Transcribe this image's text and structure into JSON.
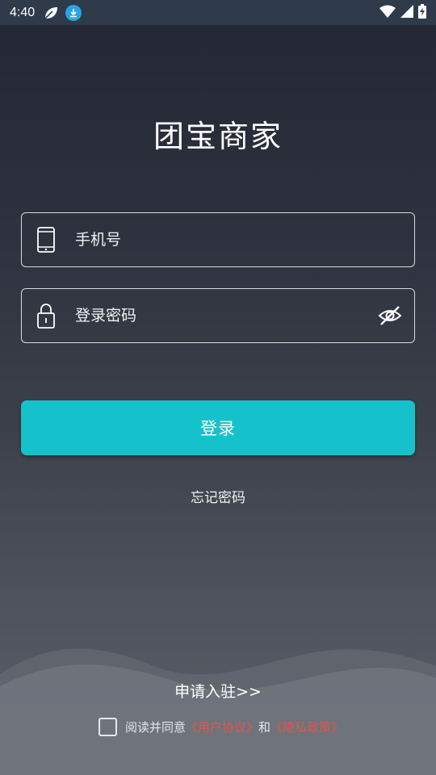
{
  "status_bar": {
    "time": "4:40",
    "icons": [
      "leaf-icon",
      "download-icon",
      "wifi-icon",
      "signal-icon",
      "battery-icon"
    ]
  },
  "app": {
    "title": "团宝商家"
  },
  "form": {
    "phone_placeholder": "手机号",
    "phone_value": "",
    "password_placeholder": "登录密码",
    "password_value": "",
    "password_visibility": "hidden"
  },
  "actions": {
    "login_label": "登录",
    "forgot_label": "忘记密码",
    "apply_label": "申请入驻>>"
  },
  "agreement": {
    "checked": false,
    "prefix": "阅读并同意",
    "user_agreement": "《用户协议》",
    "conjunction": "和",
    "privacy_policy": "《隐私政策》"
  },
  "colors": {
    "accent": "#15c2cc",
    "link": "#e2574c",
    "status_bar": "#2f3a4a"
  }
}
